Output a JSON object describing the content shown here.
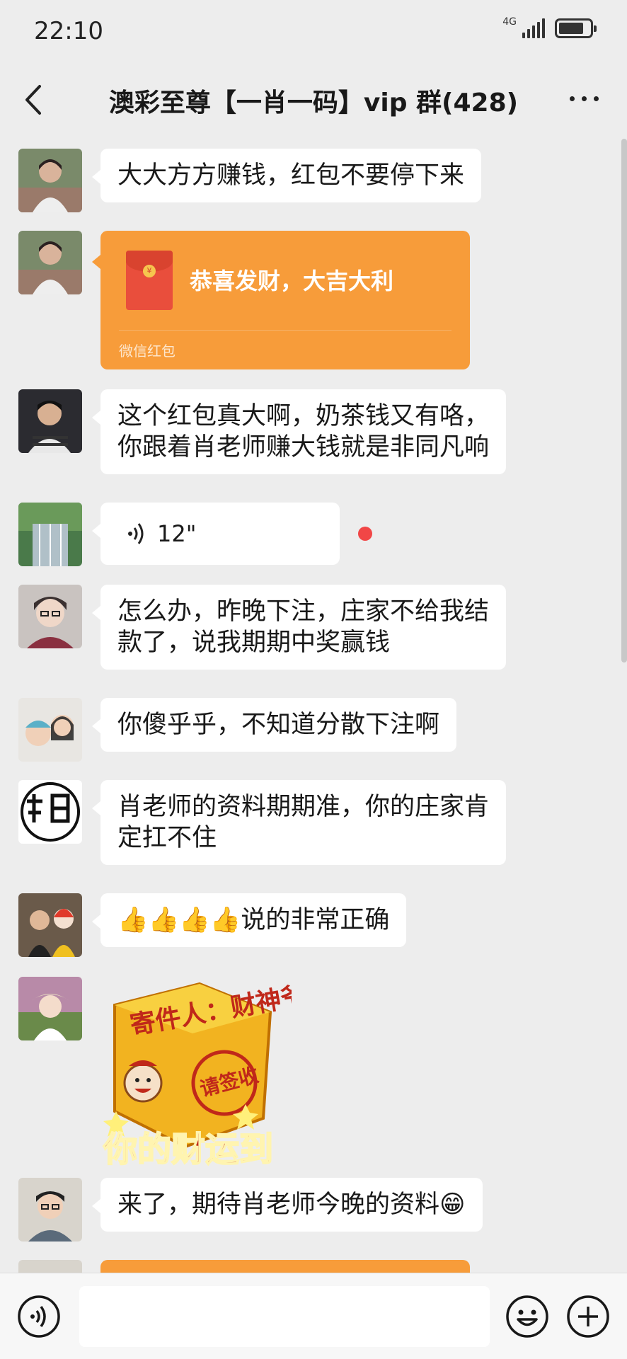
{
  "status_bar": {
    "time": "22:10",
    "network": "4G",
    "battery_percent": 82
  },
  "header": {
    "title": "澳彩至尊【一肖一码】vip 群(428)"
  },
  "messages": [
    {
      "type": "text",
      "lines": [
        "大大方方赚钱，红包不要停下来"
      ]
    },
    {
      "type": "red_packet",
      "greeting": "恭喜发财，大吉大利",
      "label": "微信红包"
    },
    {
      "type": "text",
      "lines": [
        "这个红包真大啊，奶茶钱又有咯，",
        "你跟着肖老师赚大钱就是非同凡响"
      ]
    },
    {
      "type": "voice",
      "duration": "12\""
    },
    {
      "type": "text",
      "lines": [
        "怎么办，昨晚下注，庄家不给我结",
        "款了，说我期期中奖赢钱"
      ]
    },
    {
      "type": "text",
      "lines": [
        "你傻乎乎，不知道分散下注啊"
      ]
    },
    {
      "type": "text",
      "lines": [
        "肖老师的资料期期准，你的庄家肯",
        "定扛不住"
      ]
    },
    {
      "type": "text",
      "lines": [
        "👍👍👍👍说的非常正确"
      ]
    },
    {
      "type": "sticker",
      "top_text": "寄件人：财神爷",
      "stamp_text": "请签收",
      "bottom_text": "你的财运到"
    },
    {
      "type": "text",
      "lines": [
        "来了，期待肖老师今晚的资料😁"
      ]
    }
  ],
  "input_bar": {
    "placeholder": ""
  },
  "colors": {
    "background": "#ededed",
    "red_packet": "#f79c3a",
    "unread_dot": "#f14646"
  }
}
